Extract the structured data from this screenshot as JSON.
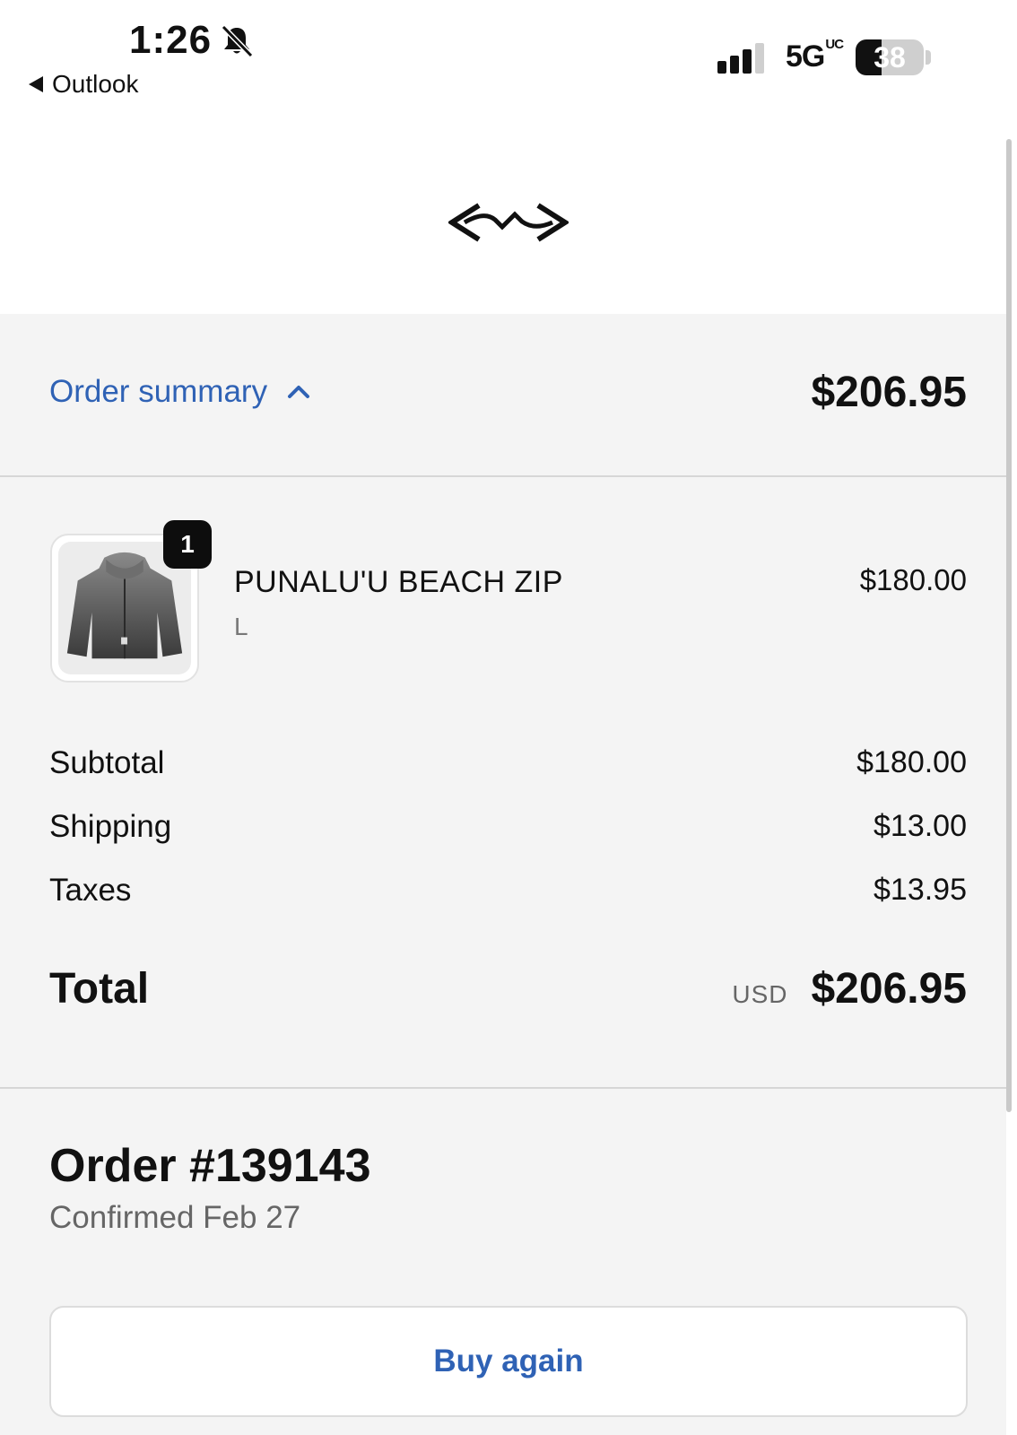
{
  "status_bar": {
    "time": "1:26",
    "back_app": "Outlook",
    "network": "5G",
    "network_suffix": "UC",
    "battery_level": "38"
  },
  "icons": {
    "bell": "silent-bell-icon",
    "signal": "cellular-signal-icon",
    "battery": "battery-icon",
    "logo": "brand-logo-icon",
    "chevron": "chevron-up-icon"
  },
  "summary": {
    "toggle_label": "Order summary",
    "amount": "$206.95"
  },
  "product": {
    "quantity": "1",
    "name": "PUNALU'U BEACH ZIP",
    "variant": "L",
    "price": "$180.00"
  },
  "costs": [
    {
      "label": "Subtotal",
      "value": "$180.00"
    },
    {
      "label": "Shipping",
      "value": "$13.00"
    },
    {
      "label": "Taxes",
      "value": "$13.95"
    }
  ],
  "total": {
    "label": "Total",
    "currency": "USD",
    "value": "$206.95"
  },
  "order": {
    "number": "Order #139143",
    "status": "Confirmed Feb 27"
  },
  "actions": {
    "buy_again": "Buy again"
  },
  "colors": {
    "accent": "#2f62b5",
    "panel_bg": "#f4f4f4",
    "text": "#111111"
  }
}
